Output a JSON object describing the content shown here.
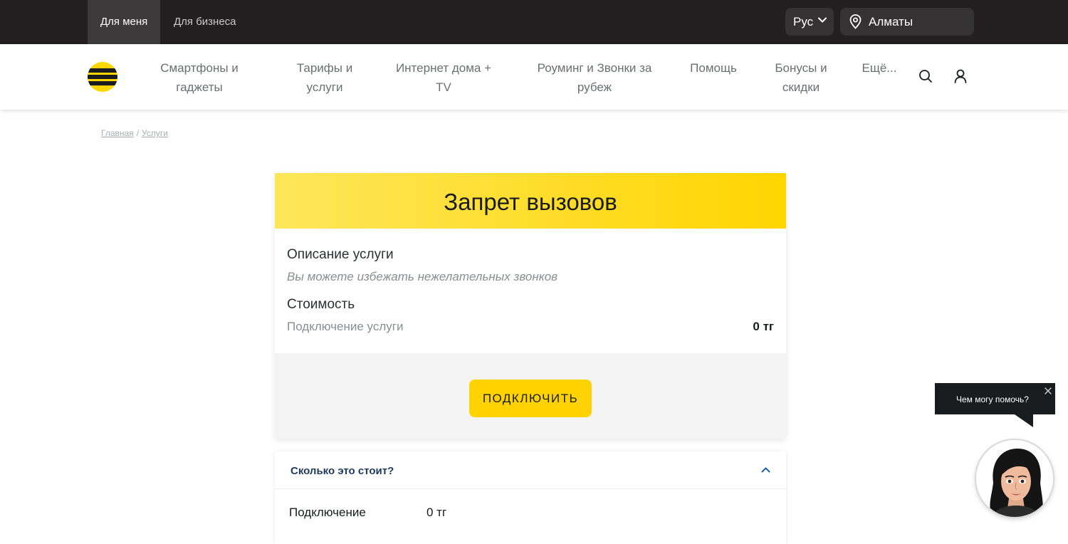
{
  "topbar": {
    "tabs": [
      {
        "label": "Для меня",
        "active": true
      },
      {
        "label": "Для бизнеса",
        "active": false
      }
    ],
    "language": "Рус",
    "city": "Алматы"
  },
  "nav": {
    "items": [
      {
        "line1": "Смартфоны и",
        "line2": "гаджеты"
      },
      {
        "line1": "Тарифы и",
        "line2": "услуги"
      },
      {
        "line1": "Интернет дома +",
        "line2": "TV"
      },
      {
        "line1": "Роуминг и Звонки за",
        "line2": "рубеж"
      },
      {
        "line1": "Помощь",
        "line2": ""
      },
      {
        "line1": "Бонусы и",
        "line2": "скидки"
      },
      {
        "line1": "Ещё...",
        "line2": ""
      }
    ]
  },
  "breadcrumb": {
    "home": "Главная",
    "separator": "/",
    "current": "Услуги"
  },
  "card": {
    "title": "Запрет вызовов",
    "description_label": "Описание услуги",
    "description": "Вы можете избежать нежелательных звонков",
    "cost_label": "Стоимость",
    "connection_label": "Подключение услуги",
    "connection_price": "0 тг",
    "connect_button": "ПОДКЛЮЧИТЬ"
  },
  "accordion": {
    "title": "Сколько это стоит?",
    "row_label": "Подключение",
    "row_value": "0 тг"
  },
  "chat": {
    "prompt": "Чем могу помочь?"
  },
  "colors": {
    "brand_yellow": "#ffd200",
    "topbar": "#231f20",
    "accordion_title": "#1d3a5f"
  }
}
